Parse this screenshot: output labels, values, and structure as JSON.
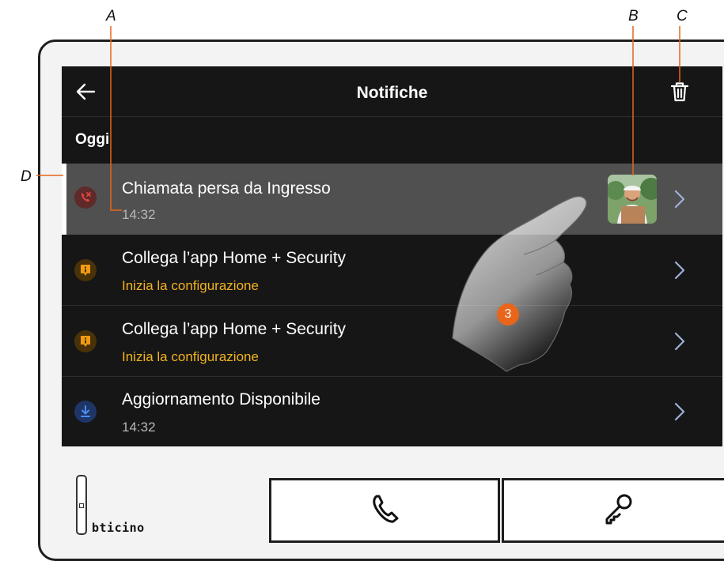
{
  "annotations": {
    "a": "A",
    "b": "B",
    "c": "C",
    "d": "D",
    "step": "3"
  },
  "header": {
    "title": "Notifiche",
    "back_icon": "arrow-left-icon",
    "delete_icon": "trash-icon"
  },
  "section_title": "Oggi",
  "notifications": [
    {
      "title": "Chiamata persa da Ingresso",
      "subtitle": "14:32",
      "icon": "missed-call-icon",
      "has_thumbnail": true,
      "highlighted": true
    },
    {
      "title": "Collega l’app Home + Security",
      "subtitle": "Inizia la configurazione",
      "icon": "info-alert-icon"
    },
    {
      "title": "Collega l’app Home + Security",
      "subtitle": "Inizia la configurazione",
      "icon": "info-alert-icon"
    },
    {
      "title": "Aggiornamento Disponibile",
      "subtitle": "14:32",
      "icon": "download-icon"
    }
  ],
  "bottom_bar": {
    "brand": "bticino",
    "call_icon": "phone-icon",
    "door_icon": "key-icon"
  },
  "colors": {
    "accent_orange": "#e8651b",
    "subtitle_yellow": "#f2b21e",
    "timestamp_grey": "#b8b8b8",
    "missed_call_red": "#e0463b",
    "download_blue": "#3b82f6",
    "screen_bg": "#161616",
    "highlight_row": "#505050"
  }
}
